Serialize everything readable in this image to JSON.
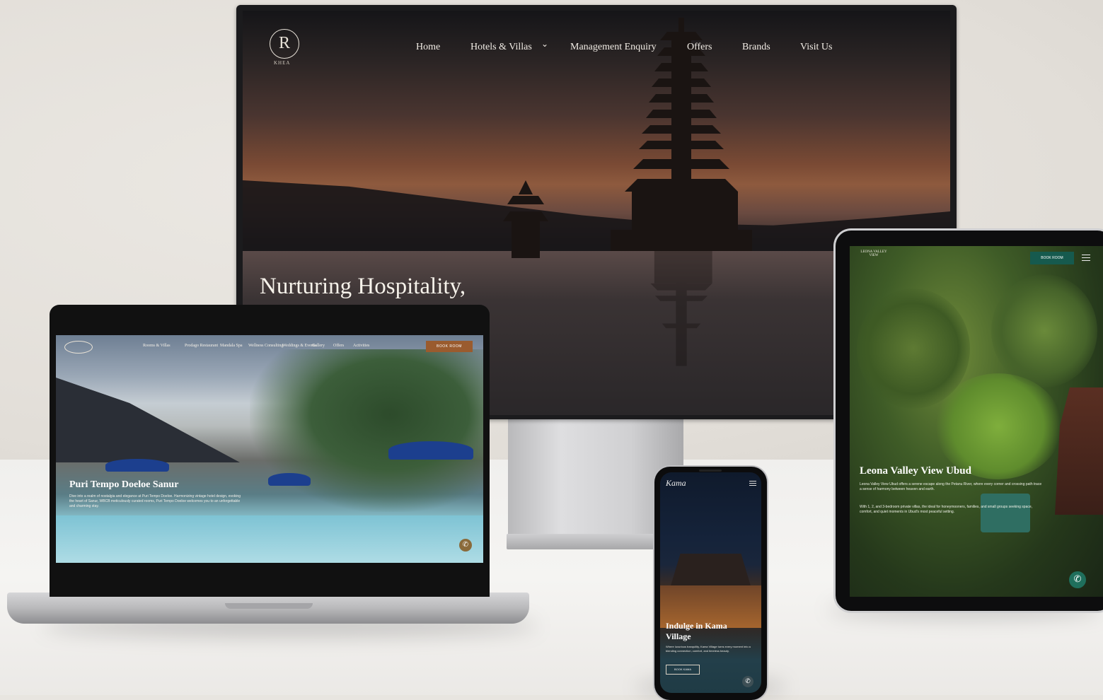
{
  "monitor": {
    "logo_letter": "R",
    "logo_text": "KHEA",
    "nav": [
      "Home",
      "Hotels & Villas",
      "Management Enquiry",
      "Offers",
      "Brands",
      "Visit Us"
    ],
    "hotels_chevron": "⌄",
    "hero_heading": "Nurturing Hospitality,"
  },
  "laptop": {
    "nav": [
      "Rooms & Villas",
      "Prodago Restaurant",
      "Mandala Spa",
      "Wellness Consulting",
      "Weddings & Events",
      "Gallery",
      "Offers",
      "Activities"
    ],
    "book_button": "BOOK ROOM",
    "hero_title": "Puri Tempo Doeloe Sanur",
    "hero_desc": "Dive into a realm of nostalgia and elegance at Puri Tempo Doeloe. Harmonizing vintage hotel design, evoking the heart of Sanur, WBCB meticulously curated rooms, Puri Tempo Doeloe welcomes you to an unforgettable and charming stay."
  },
  "tablet": {
    "book_button": "BOOK ROOM",
    "logo_text": "LEONA VALLEY VIEW",
    "hero_title": "Leona Valley View Ubud",
    "para1": "Leona Valley View Ubud offers a serene escape along the Petanu River, where every corner and crossing path trace a sense of harmony between heaven and earth.",
    "para2": "With 1, 2, and 3-bedroom private villas, the ideal for honeymooners, families, and small groups seeking space, comfort, and quiet moments in Ubud's most peaceful setting."
  },
  "phone": {
    "logo": "Kama",
    "hero_title": "Indulge in Kama Village",
    "hero_desc": "Where luxurious tranquility, Kama Village turns every moment into a blending connection, comfort, and timeless beauty.",
    "button": "BOOK KAMA"
  },
  "icons": {
    "whatsapp": "✆"
  }
}
